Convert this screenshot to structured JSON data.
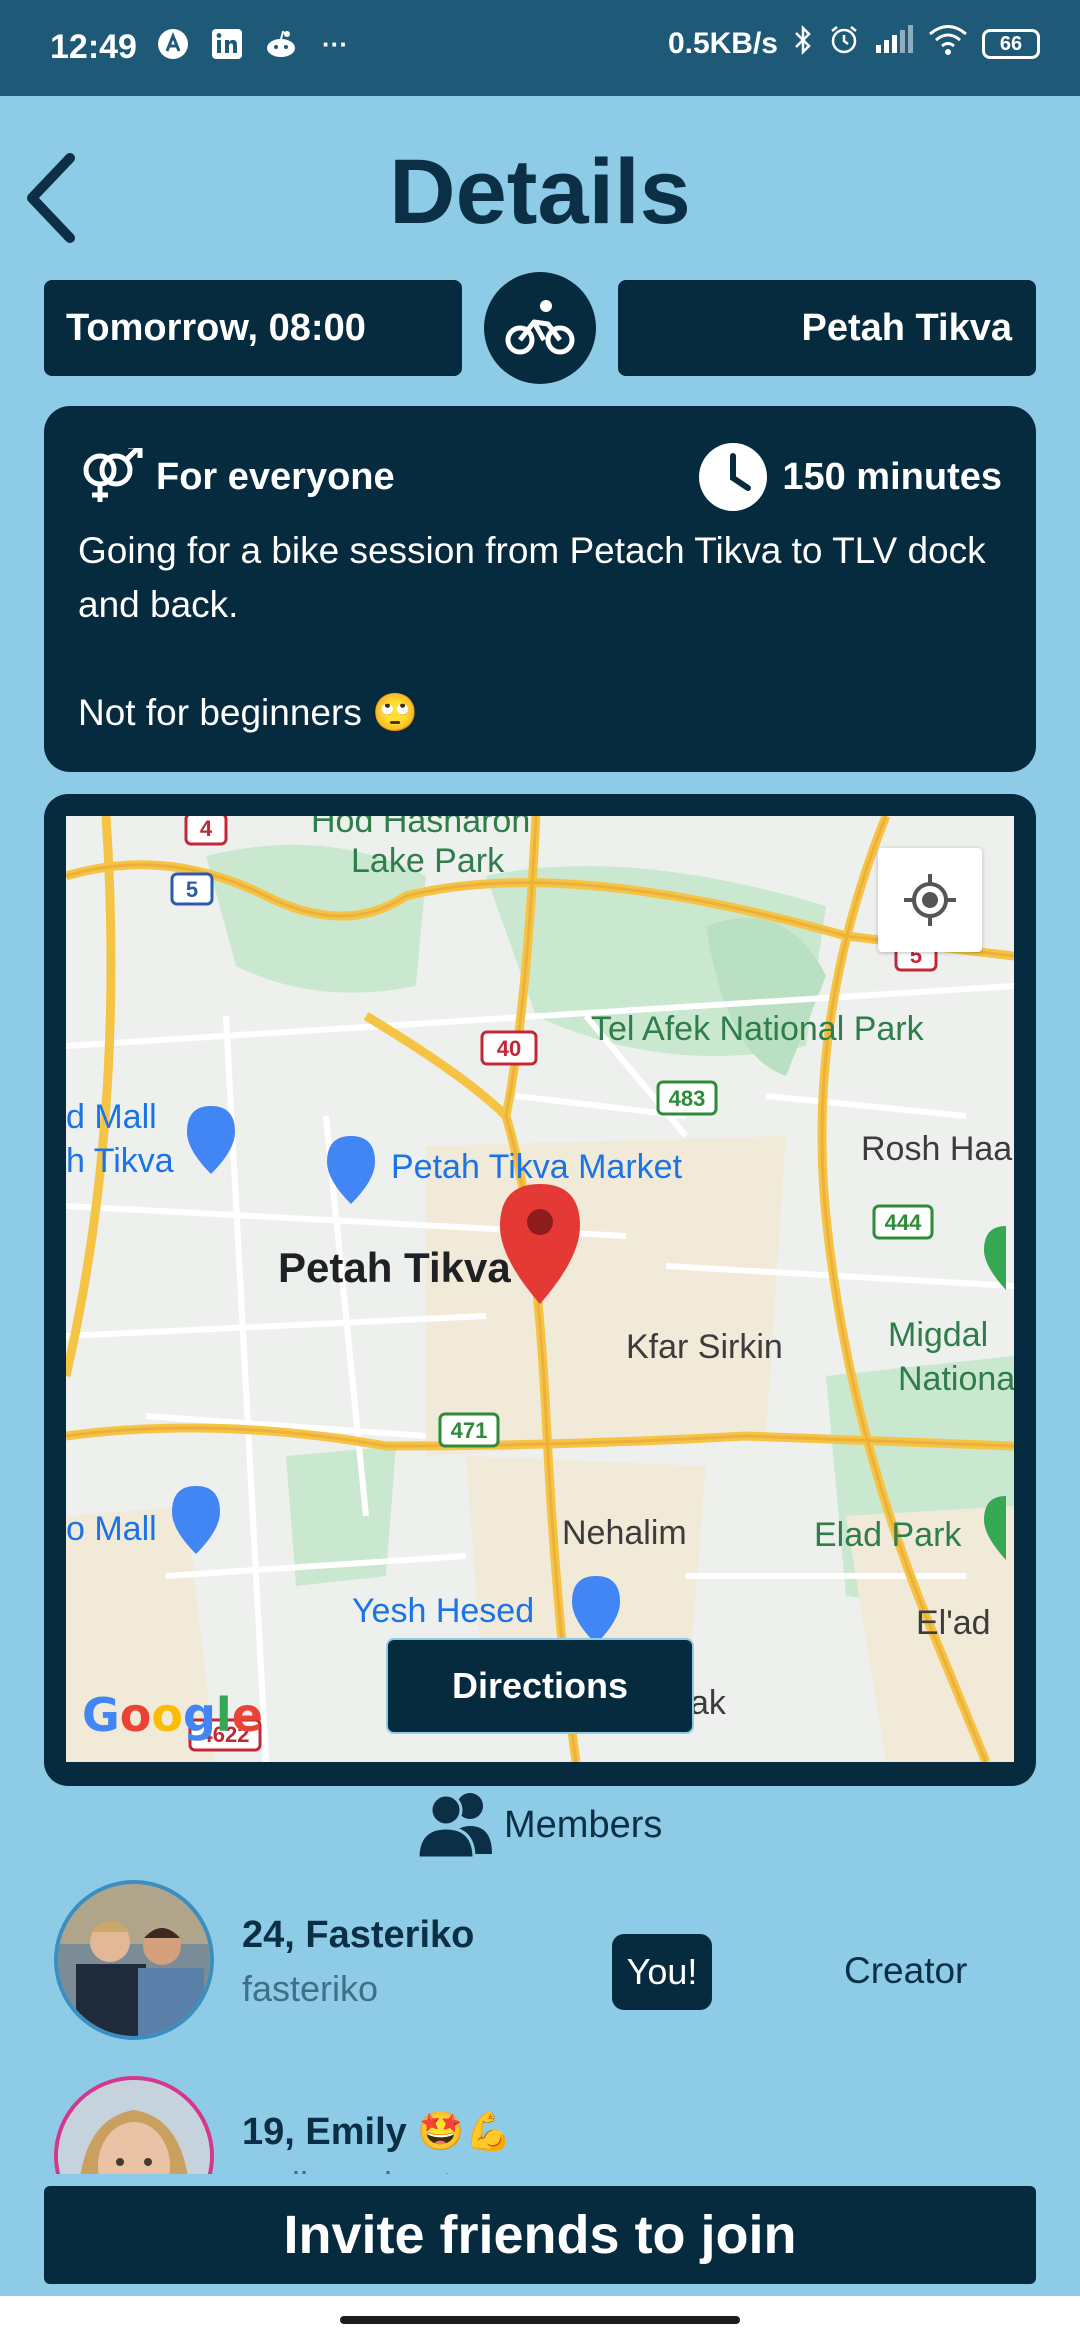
{
  "status_bar": {
    "time": "12:49",
    "notification_icons": [
      "app-a-icon",
      "linkedin-icon",
      "reddit-icon",
      "more-icon"
    ],
    "more": "···",
    "net_speed": "0.5KB/s",
    "battery": "66"
  },
  "header": {
    "title": "Details",
    "back_icon": "chevron-left-icon"
  },
  "event": {
    "datetime": "Tomorrow, 08:00",
    "activity_icon": "bike-icon",
    "city": "Petah Tikva",
    "audience": "For everyone",
    "audience_icon": "gender-icon",
    "duration": "150 minutes",
    "duration_icon": "clock-icon",
    "description_line1": "Going for a bike session from Petach Tikva to TLV dock and back.",
    "description_line2": "Not for beginners 🙄"
  },
  "map": {
    "labels": {
      "hod_hasharon": "Hod Hasharon",
      "lake_park": "Lake Park",
      "tel_afek": "Tel Afek National Park",
      "mall_top": "d Mall",
      "tikva_left": "h Tikva",
      "market": "Petah Tikva Market",
      "rosh_haayin": "Rosh Haa",
      "petah_tikva": "Petah Tikva",
      "kfar_sirkin": "Kfar Sirkin",
      "migdal": "Migdal",
      "nationa": "Nationa",
      "mall_bottom": "o Mall",
      "nehalim": "Nehalim",
      "elad_park": "Elad Park",
      "yesh_hesed": "Yesh Hesed",
      "elad": "El'ad",
      "ak": "ak"
    },
    "road_shields": {
      "r4": "4",
      "r5a": "5",
      "r5b": "5",
      "r40": "40",
      "r483": "483",
      "r444": "444",
      "r471": "471",
      "r4622": "4622"
    },
    "directions_label": "Directions",
    "google_logo": "Google",
    "my_location_icon": "crosshair-icon",
    "pin_icon": "map-pin-icon"
  },
  "members": {
    "header_label": "Members",
    "header_icon": "people-icon",
    "list": [
      {
        "name": "24, Fasteriko",
        "username": "fasteriko",
        "badge": "You!",
        "role": "Creator"
      },
      {
        "name": "19, Emily 🤩💪",
        "username": "emilyworkout",
        "badge": "",
        "role": ""
      }
    ]
  },
  "invite_label": "Invite friends to join",
  "colors": {
    "background": "#8ecbe6",
    "primary": "#062a3e",
    "status_bar": "#1e5a78",
    "map_pin": "#e53935"
  }
}
